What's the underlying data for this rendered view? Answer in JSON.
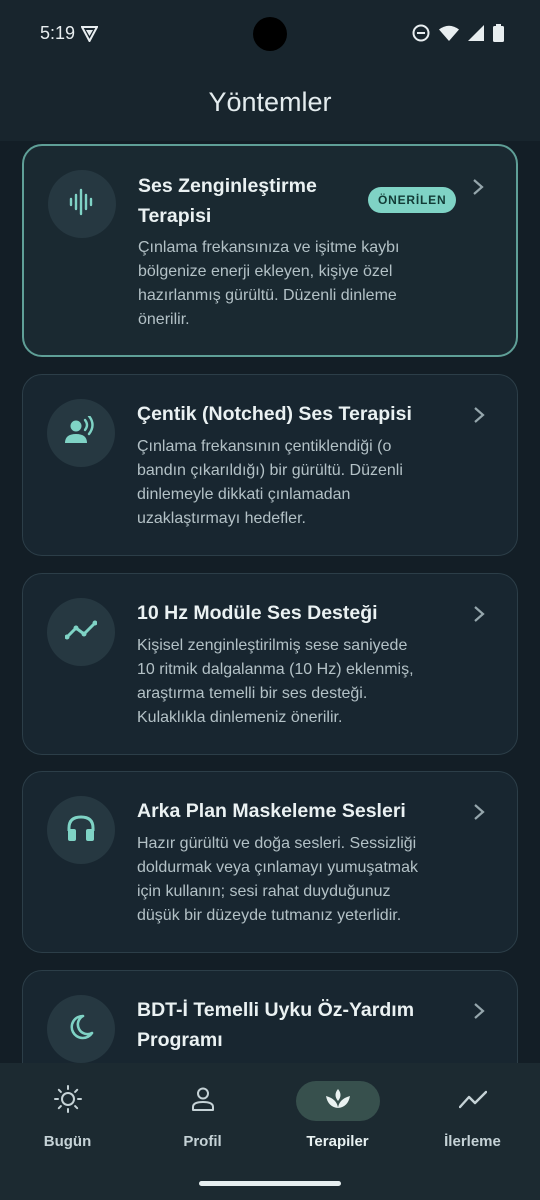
{
  "status_bar": {
    "time": "5:19",
    "icons": [
      "vpn-icon",
      "do-not-disturb-icon",
      "wifi-icon",
      "signal-icon",
      "battery-icon"
    ]
  },
  "app_bar": {
    "title": "Yöntemler"
  },
  "colors": {
    "background": "#131e26",
    "card": "#182630",
    "accent": "#7fd3c5",
    "selected_border": "#5f9f97"
  },
  "cards": [
    {
      "title_line1": "Ses Zenginleştirme",
      "title_line2": "Terapisi",
      "badge": "ÖNERİLEN",
      "icon": "sound-wave-icon",
      "desc": [
        "Çınlama frekansınıza ve işitme kaybı",
        "bölgenize enerji ekleyen, kişiye özel",
        "hazırlanmış gürültü. Düzenli dinleme",
        "önerilir."
      ]
    },
    {
      "title_line1": "Çentik (Notched) Ses Terapisi",
      "icon": "person-voice-icon",
      "desc": [
        "Çınlama frekansının çentiklendiği (o",
        "bandın çıkarıldığı) bir gürültü. Düzenli",
        "dinlemeyle dikkati çınlamadan",
        "uzaklaştırmayı hedefler."
      ]
    },
    {
      "title_line1": "10 Hz Modüle Ses Desteği",
      "icon": "trend-line-icon",
      "desc": [
        "Kişisel zenginleştirilmiş sese saniyede",
        "10 ritmik dalgalanma (10 Hz) eklenmiş,",
        "araştırma temelli bir ses desteği.",
        "Kulaklıkla dinlemeniz önerilir."
      ]
    },
    {
      "title_line1": "Arka Plan Maskeleme Sesleri",
      "icon": "headphones-icon",
      "desc": [
        "Hazır gürültü ve doğa sesleri. Sessizliği",
        "doldurmak veya çınlamayı yumuşatmak",
        "için kullanın; sesi rahat duyduğunuz",
        "düşük bir düzeyde tutmanız yeterlidir."
      ]
    },
    {
      "title_line1": "BDT-İ Temelli Uyku Öz-Yardım",
      "title_line2": "Programı",
      "icon": "moon-icon"
    }
  ],
  "bottom_nav": [
    {
      "label": "Bugün",
      "icon": "sun-icon"
    },
    {
      "label": "Profil",
      "icon": "person-icon"
    },
    {
      "label": "Terapiler",
      "icon": "lotus-icon",
      "active": true
    },
    {
      "label": "İlerleme",
      "icon": "trend-icon"
    }
  ]
}
